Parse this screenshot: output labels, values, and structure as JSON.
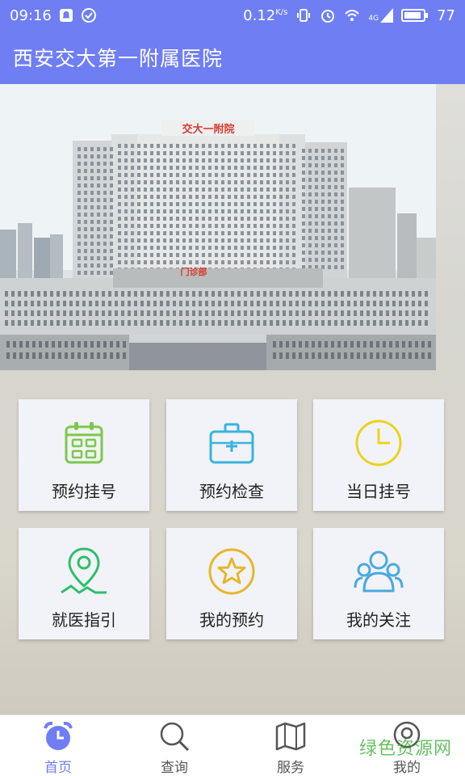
{
  "status_bar": {
    "time": "09:16",
    "network_speed": "0.12",
    "network_unit": "K/s",
    "network_type": "4G",
    "battery": "77",
    "icons": [
      "notification-icon",
      "check-circle-icon",
      "vibrate-icon",
      "alarm-icon",
      "wifi-icon",
      "signal-icon",
      "battery-icon"
    ]
  },
  "app_bar": {
    "title": "西安交大第一附属医院"
  },
  "hero": {
    "roof_sign": "交大一附院",
    "entrance_sign": "门诊部"
  },
  "cards": [
    {
      "label": "预约挂号",
      "icon": "calendar-icon",
      "color": "#7cc84b"
    },
    {
      "label": "预约检查",
      "icon": "medical-kit-icon",
      "color": "#39b3e0"
    },
    {
      "label": "当日挂号",
      "icon": "clock-icon",
      "color": "#e8d41e"
    },
    {
      "label": "就医指引",
      "icon": "location-pin-icon",
      "color": "#2dbf6b"
    },
    {
      "label": "我的预约",
      "icon": "star-icon",
      "color": "#e7b62b"
    },
    {
      "label": "我的关注",
      "icon": "users-icon",
      "color": "#4aa8de"
    }
  ],
  "bottom_nav": [
    {
      "label": "首页",
      "icon": "alarm-clock-icon",
      "active": true
    },
    {
      "label": "查询",
      "icon": "search-icon",
      "active": false
    },
    {
      "label": "服务",
      "icon": "map-book-icon",
      "active": false
    },
    {
      "label": "我的",
      "icon": "profile-icon",
      "active": false
    }
  ],
  "watermark": "绿色资源网",
  "colors": {
    "primary": "#6f7ef3",
    "card_bg": "#f2f3f8",
    "nav_active": "#6f7ef3"
  }
}
